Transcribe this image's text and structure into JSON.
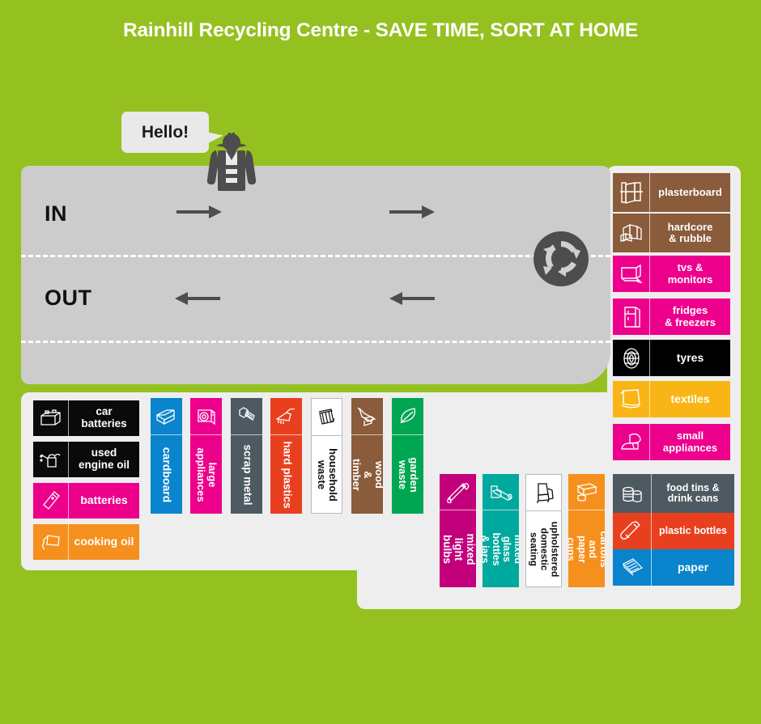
{
  "page": {
    "title": "Rainhill Recycling Centre - SAVE TIME, SORT AT HOME",
    "background_color": "#94c11f"
  },
  "site": {
    "in_label": "IN",
    "out_label": "OUT",
    "road_color": "#cccccc",
    "panel_color": "#eeeeee",
    "speech_bubble_text": "Hello!",
    "arrows": [
      {
        "name": "in-arrow-1",
        "direction": "right"
      },
      {
        "name": "in-arrow-2",
        "direction": "right"
      },
      {
        "name": "out-arrow-1",
        "direction": "left"
      },
      {
        "name": "out-arrow-2",
        "direction": "left"
      }
    ],
    "recycle_icon": "recycle-arrows-icon",
    "worker_icon": "worker-hi-vis-hard-hat-icon"
  },
  "right_column_cards": [
    {
      "label": "plasterboard",
      "icon": "plasterboard-icon",
      "color": "#8a5c3b",
      "text_color": "#ffffff"
    },
    {
      "label": "hardcore\n& rubble",
      "icon": "rubble-icon",
      "color": "#8a5c3b",
      "text_color": "#ffffff"
    },
    {
      "label": "tvs &\nmonitors",
      "icon": "monitor-icon",
      "color": "#ec008c",
      "text_color": "#ffffff"
    },
    {
      "label": "fridges\n& freezers",
      "icon": "fridge-icon",
      "color": "#ec008c",
      "text_color": "#ffffff"
    },
    {
      "label": "tyres",
      "icon": "tyre-icon",
      "color": "#000000",
      "text_color": "#ffffff"
    },
    {
      "label": "textiles",
      "icon": "textiles-icon",
      "color": "#f9b515",
      "text_color": "#ffffff"
    },
    {
      "label": "small\nappliances",
      "icon": "hairdryer-iron-icon",
      "color": "#ec008c",
      "text_color": "#ffffff"
    }
  ],
  "right_lower_cards": [
    {
      "label": "food tins &\ndrink cans",
      "icon": "tin-cans-icon",
      "color": "#4d5a61",
      "text_color": "#ffffff"
    },
    {
      "label": "plastic bottles",
      "icon": "plastic-bottle-icon",
      "color": "#e8401f",
      "text_color": "#ffffff"
    },
    {
      "label": "paper",
      "icon": "paper-sheets-icon",
      "color": "#0a84cc",
      "text_color": "#ffffff"
    }
  ],
  "left_cards": [
    {
      "label": "car\nbatteries",
      "icon": "car-battery-icon",
      "color": "#0a0a0a",
      "text_color": "#ffffff"
    },
    {
      "label": "used\nengine oil",
      "icon": "oil-can-icon",
      "color": "#0a0a0a",
      "text_color": "#ffffff"
    },
    {
      "label": "batteries",
      "icon": "battery-icon",
      "color": "#ec008c",
      "text_color": "#ffffff"
    },
    {
      "label": "cooking oil",
      "icon": "oil-bottle-icon",
      "color": "#f5901e",
      "text_color": "#ffffff"
    }
  ],
  "middle_vertical_cards": [
    {
      "label": "cardboard",
      "icon": "cardboard-box-icon",
      "color": "#0a84cc",
      "text_color": "#ffffff"
    },
    {
      "label": "large\nappliances",
      "icon": "washing-machine-icon",
      "color": "#ec008c",
      "text_color": "#ffffff"
    },
    {
      "label": "scrap metal",
      "icon": "bolt-icon",
      "color": "#4d5a61",
      "text_color": "#ffffff"
    },
    {
      "label": "hard plastics",
      "icon": "hard-plastics-icon",
      "color": "#e8401f",
      "text_color": "#ffffff"
    },
    {
      "label": "household\nwaste",
      "icon": "wheelie-bin-icon",
      "color": "#ffffff",
      "text_color": "#111111"
    },
    {
      "label": "wood\n& timber",
      "icon": "timber-icon",
      "color": "#8a5c3b",
      "text_color": "#ffffff"
    },
    {
      "label": "garden\nwaste",
      "icon": "leaf-icon",
      "color": "#00a651",
      "text_color": "#ffffff"
    }
  ],
  "lower_vertical_cards": [
    {
      "label": "mixed light\nbulbs",
      "icon": "light-bulbs-icon",
      "color": "#c2007b",
      "text_color": "#ffffff"
    },
    {
      "label": "mixed glass\nbottles & jars",
      "icon": "glass-bottles-icon",
      "color": "#00a99d",
      "text_color": "#ffffff"
    },
    {
      "label": "upholstered\ndomestic seating",
      "icon": "armchair-icon",
      "color": "#ffffff",
      "text_color": "#111111"
    },
    {
      "label": "cartons and\npaper cups",
      "icon": "carton-cup-icon",
      "color": "#f5901e",
      "text_color": "#ffffff"
    }
  ]
}
